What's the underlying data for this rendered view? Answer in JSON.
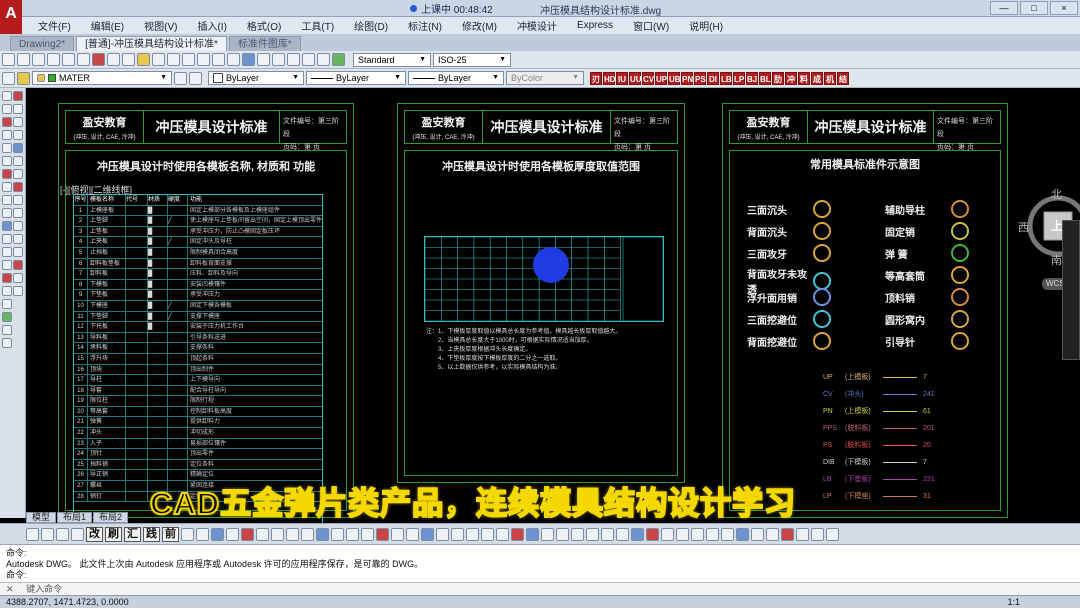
{
  "window": {
    "recording": "上课中 00:48:42",
    "document_title": "冲压模具结构设计标准.dwg",
    "controls": [
      "—",
      "□",
      "×"
    ]
  },
  "menu": [
    "文件(F)",
    "编辑(E)",
    "视图(V)",
    "插入(I)",
    "格式(O)",
    "工具(T)",
    "绘图(D)",
    "标注(N)",
    "修改(M)",
    "冲模设计",
    "Express",
    "窗口(W)",
    "说明(H)"
  ],
  "tabs": [
    "Drawing2*",
    "[普通]-冲压模具结构设计标准*",
    "标准件图库*"
  ],
  "toolbar": {
    "text_style": "Standard",
    "dim_style": "ISO-25",
    "layer": "MATER",
    "color": "ByLayer",
    "linetype": "ByLayer",
    "lineweight": "ByLayer",
    "plotstyle": "ByColor",
    "red_tools": [
      "刃",
      "HD",
      "IU",
      "UU",
      "CV",
      "UP",
      "UB",
      "PN",
      "PS",
      "DI",
      "LB",
      "LP",
      "BJ",
      "BL",
      "肋",
      "冲",
      "料",
      "成",
      "机",
      "结"
    ]
  },
  "viewport_label": "[-][俯视][二维线框]",
  "sheets": [
    {
      "org": "盈安教育",
      "org_sub": "(冲压, 设计, CAE, 冷冲)",
      "title": "冲压模具设计标准",
      "doc_no": "文件编号：第三阶段",
      "page": "页码：第 页",
      "subtitle": "冲压模具设计时使用各模板名称, 材质和 功能",
      "table_header": [
        "序号",
        "模板名称",
        "代号",
        "材质",
        "硬度",
        "功能"
      ],
      "rows": [
        [
          "1",
          "上模座板",
          "",
          "█",
          "",
          "固定上模部分各模板及上模座组件"
        ],
        [
          "2",
          "上垫脚",
          "",
          "█",
          "╱",
          "使上模座与上垫板间留出空间，固定上模顶出零件"
        ],
        [
          "3",
          "上垫板",
          "",
          "█",
          "",
          "承受冲压力，防止凸模固定板压坏"
        ],
        [
          "4",
          "上夹板",
          "",
          "█",
          "╱",
          "固定冲头及导柱"
        ],
        [
          "5",
          "止挡板",
          "",
          "█",
          "",
          "限制模具闭合高度"
        ],
        [
          "6",
          "卸料板垫板",
          "",
          "█",
          "",
          "卸料板背面支撑"
        ],
        [
          "7",
          "卸料板",
          "",
          "█",
          "",
          "压料、卸料及导向"
        ],
        [
          "8",
          "下模板",
          "",
          "█",
          "",
          "安装凹模镶件"
        ],
        [
          "9",
          "下垫板",
          "",
          "█",
          "",
          "承受冲压力"
        ],
        [
          "10",
          "下模座",
          "",
          "█",
          "╱",
          "固定下模各模板"
        ],
        [
          "11",
          "下垫脚",
          "",
          "█",
          "╱",
          "支撑下模座"
        ],
        [
          "12",
          "下托板",
          "",
          "█",
          "",
          "安装于压力机工作台"
        ],
        [
          "13",
          "导料板",
          "",
          "",
          "",
          "引导条料送进"
        ],
        [
          "14",
          "承料板",
          "",
          "",
          "",
          "支撑条料"
        ],
        [
          "15",
          "浮升块",
          "",
          "",
          "",
          "顶起条料"
        ],
        [
          "16",
          "顶块",
          "",
          "",
          "",
          "顶出制件"
        ],
        [
          "17",
          "导柱",
          "",
          "",
          "",
          "上下模导向"
        ],
        [
          "18",
          "导套",
          "",
          "",
          "",
          "配合导柱导向"
        ],
        [
          "19",
          "限位柱",
          "",
          "",
          "",
          "限制行程"
        ],
        [
          "20",
          "等高套",
          "",
          "",
          "",
          "控制卸料板高度"
        ],
        [
          "21",
          "弹簧",
          "",
          "",
          "",
          "提供卸料力"
        ],
        [
          "22",
          "冲头",
          "",
          "",
          "",
          "冲切成形"
        ],
        [
          "23",
          "入子",
          "",
          "",
          "",
          "易损部位镶件"
        ],
        [
          "24",
          "顶针",
          "",
          "",
          "",
          "顶出零件"
        ],
        [
          "25",
          "挡料销",
          "",
          "",
          "",
          "定位条料"
        ],
        [
          "26",
          "导正销",
          "",
          "",
          "",
          "精确定位"
        ],
        [
          "27",
          "螺丝",
          "",
          "",
          "",
          "紧固连接"
        ],
        [
          "28",
          "销钉",
          "",
          "",
          "",
          "定位连接"
        ]
      ]
    },
    {
      "org": "盈安教育",
      "org_sub": "(冲压, 设计, CAE, 冷冲)",
      "title": "冲压模具设计标准",
      "doc_no": "文件编号：第三阶段",
      "page": "页码：第 页",
      "subtitle": "冲压模具设计时使用各模板厚度取值范围",
      "notes": [
        "注：1、下模板厚度取值以模具总长度为参考值，模具越长板厚取值越大。",
        "2、当模具总长度大于1000时，可根据实际情况适当加厚。",
        "3、上夹板厚度根据冲头长度确定。",
        "4、下垫板厚度按下模板厚度的二分之一选取。",
        "5、以上数据仅供参考，以实际模具结构为准。"
      ]
    },
    {
      "org": "盈安教育",
      "org_sub": "(冲压, 设计, CAE, 冷冲)",
      "title": "冲压模具设计标准",
      "doc_no": "文件编号：第三阶段",
      "page": "页码：第 页",
      "subtitle": "常用模具标准件示意图",
      "symbols_left": [
        "三面沉头",
        "背面沉头",
        "三面攻牙",
        "背面攻牙未攻透",
        "浮升面用销",
        "三面挖避位",
        "背面挖避位"
      ],
      "symbols_right": [
        "辅助导柱",
        "固定销",
        "弹 簧",
        "等高套筒",
        "顶料销",
        "圆形窝内",
        "引导针"
      ],
      "layer_legend": [
        {
          "code": "UP",
          "name": "(上模板)",
          "value": "7",
          "color": "#e0b060"
        },
        {
          "code": "CV",
          "name": "(冲头)",
          "value": "241",
          "color": "#5a7ad0"
        },
        {
          "code": "PN",
          "name": "(上模板)",
          "value": "61",
          "color": "#c8d040"
        },
        {
          "code": "PPS",
          "name": "(脱料板)",
          "value": "201",
          "color": "#c06070"
        },
        {
          "code": "PS",
          "name": "(脱料板)",
          "value": "20",
          "color": "#e05040"
        },
        {
          "code": "DIB",
          "name": "(下模板)",
          "value": "7",
          "color": "#d0d0d0"
        },
        {
          "code": "LB",
          "name": "(下垫板)",
          "value": "231",
          "color": "#b040b0"
        },
        {
          "code": "LP",
          "name": "(下模座)",
          "value": "31",
          "color": "#d08040"
        }
      ]
    }
  ],
  "compass": {
    "north": "北",
    "south": "南",
    "east": "东",
    "west": "西",
    "top": "上",
    "wcs": "WCS"
  },
  "layout_tabs": [
    "模型",
    "布局1",
    "布局2"
  ],
  "bottom_toolbar": [
    "改",
    "刷",
    "汇",
    "践",
    "前"
  ],
  "overlay_caption": "CAD五金弹片类产品，连续模具结构设计学习",
  "command": {
    "line1": "命令:",
    "line2": "Autodesk DWG。  此文件上次由 Autodesk 应用程序或 Autodesk 许可的应用程序保存，是可靠的 DWG。",
    "line3": "命令:",
    "prompt": "键入命令"
  },
  "status": {
    "coords": "4388.2707, 1471.4723, 0.0000",
    "scale": "1:1"
  }
}
